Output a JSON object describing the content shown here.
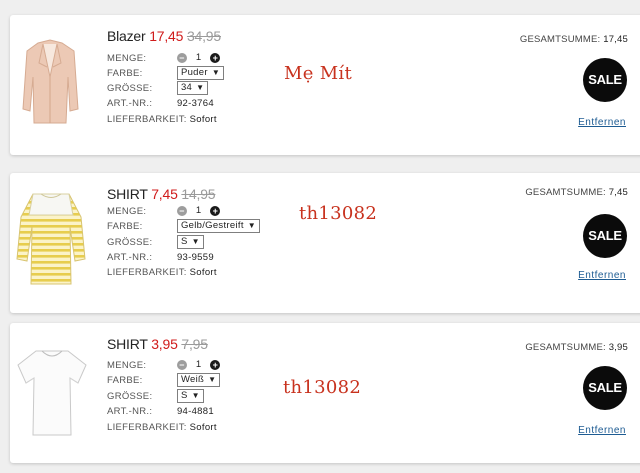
{
  "labels": {
    "menge": "MENGE:",
    "farbe": "FARBE:",
    "groesse": "GRÖSSE:",
    "artnr": "ART.-NR.:",
    "liefer": "LIEFERBARKEIT:",
    "total": "GESAMTSUMME:",
    "remove": "Entfernen",
    "sale": "SALE",
    "minus": "−",
    "plus": "+",
    "caret": "▼"
  },
  "items": [
    {
      "name": "Blazer",
      "price": "17,45",
      "old_price": "34,95",
      "quantity": "1",
      "color": "Puder",
      "size": "34",
      "article_no": "92-3764",
      "availability": "Sofort",
      "total": "17,45",
      "watermark": "Mẹ Mít"
    },
    {
      "name": "SHIRT",
      "price": "7,45",
      "old_price": "14,95",
      "quantity": "1",
      "color": "Gelb/Gestreift",
      "size": "S",
      "article_no": "93-9559",
      "availability": "Sofort",
      "total": "7,45",
      "watermark": "th13082"
    },
    {
      "name": "SHIRT",
      "price": "3,95",
      "old_price": "7,95",
      "quantity": "1",
      "color": "Weiß",
      "size": "S",
      "article_no": "94-4881",
      "availability": "Sofort",
      "total": "3,95",
      "watermark": "th13082"
    }
  ],
  "colors": {
    "sale_price": "#d01b1b",
    "old_price": "#9a9a9a",
    "link": "#1e5c93",
    "watermark": "#c8321e"
  }
}
